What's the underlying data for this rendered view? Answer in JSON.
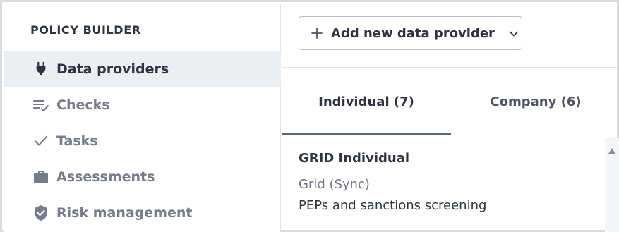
{
  "sidebar": {
    "title": "POLICY BUILDER",
    "items": [
      {
        "label": "Data providers",
        "icon": "plug-icon",
        "active": true
      },
      {
        "label": "Checks",
        "icon": "checklist-icon",
        "active": false
      },
      {
        "label": "Tasks",
        "icon": "check-icon",
        "active": false
      },
      {
        "label": "Assessments",
        "icon": "briefcase-icon",
        "active": false
      },
      {
        "label": "Risk management",
        "icon": "shield-check-icon",
        "active": false
      }
    ]
  },
  "toolbar": {
    "add_label": "Add new data provider"
  },
  "tabs": [
    {
      "label": "Individual (7)",
      "active": true
    },
    {
      "label": "Company (6)",
      "active": false
    }
  ],
  "provider": {
    "title": "GRID Individual",
    "source": "Grid (Sync)",
    "description": "PEPs and sanctions screening"
  },
  "colors": {
    "text": "#2f3342",
    "muted": "#777b8c",
    "active_bg": "#eceff2"
  }
}
